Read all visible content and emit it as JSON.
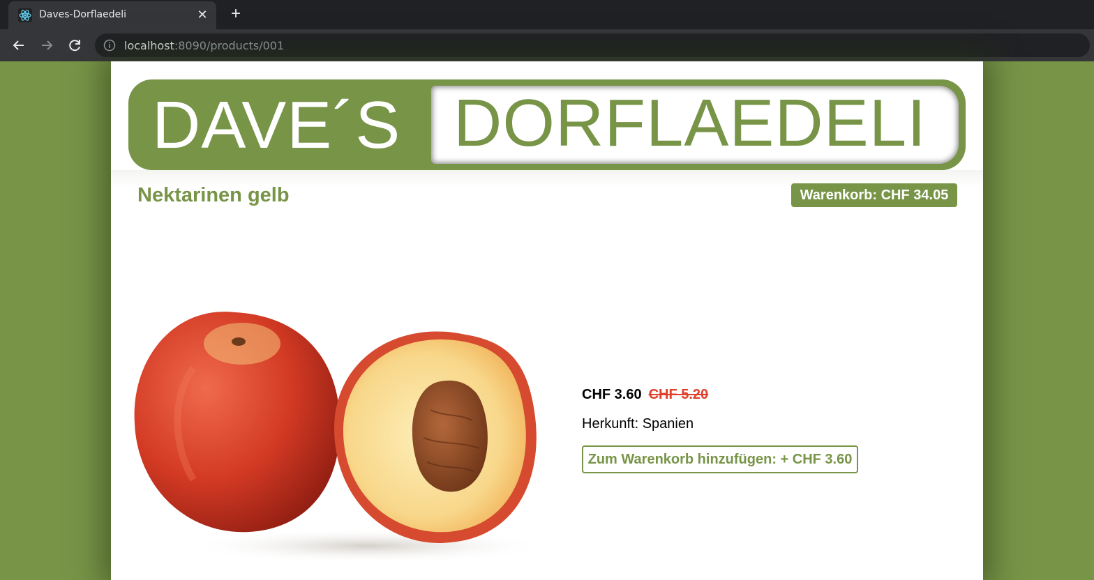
{
  "browser": {
    "tab_title": "Daves-Dorflaedeli",
    "url_host": "localhost",
    "url_path": ":8090/products/001",
    "tab_icon": "react-icon"
  },
  "site": {
    "logo_left": "DAVE´S",
    "logo_right": "DORFLAEDELI",
    "brand_color": "#779447"
  },
  "header": {
    "product_title": "Nektarinen gelb",
    "cart_label": "Warenkorb: CHF 34.05"
  },
  "product": {
    "price_current": "CHF 3.60",
    "price_old": "CHF 5.20",
    "origin": "Herkunft: Spanien",
    "add_to_cart_label": "Zum Warenkorb hinzufügen: + CHF 3.60",
    "image_subject": "nectarine-photo"
  }
}
